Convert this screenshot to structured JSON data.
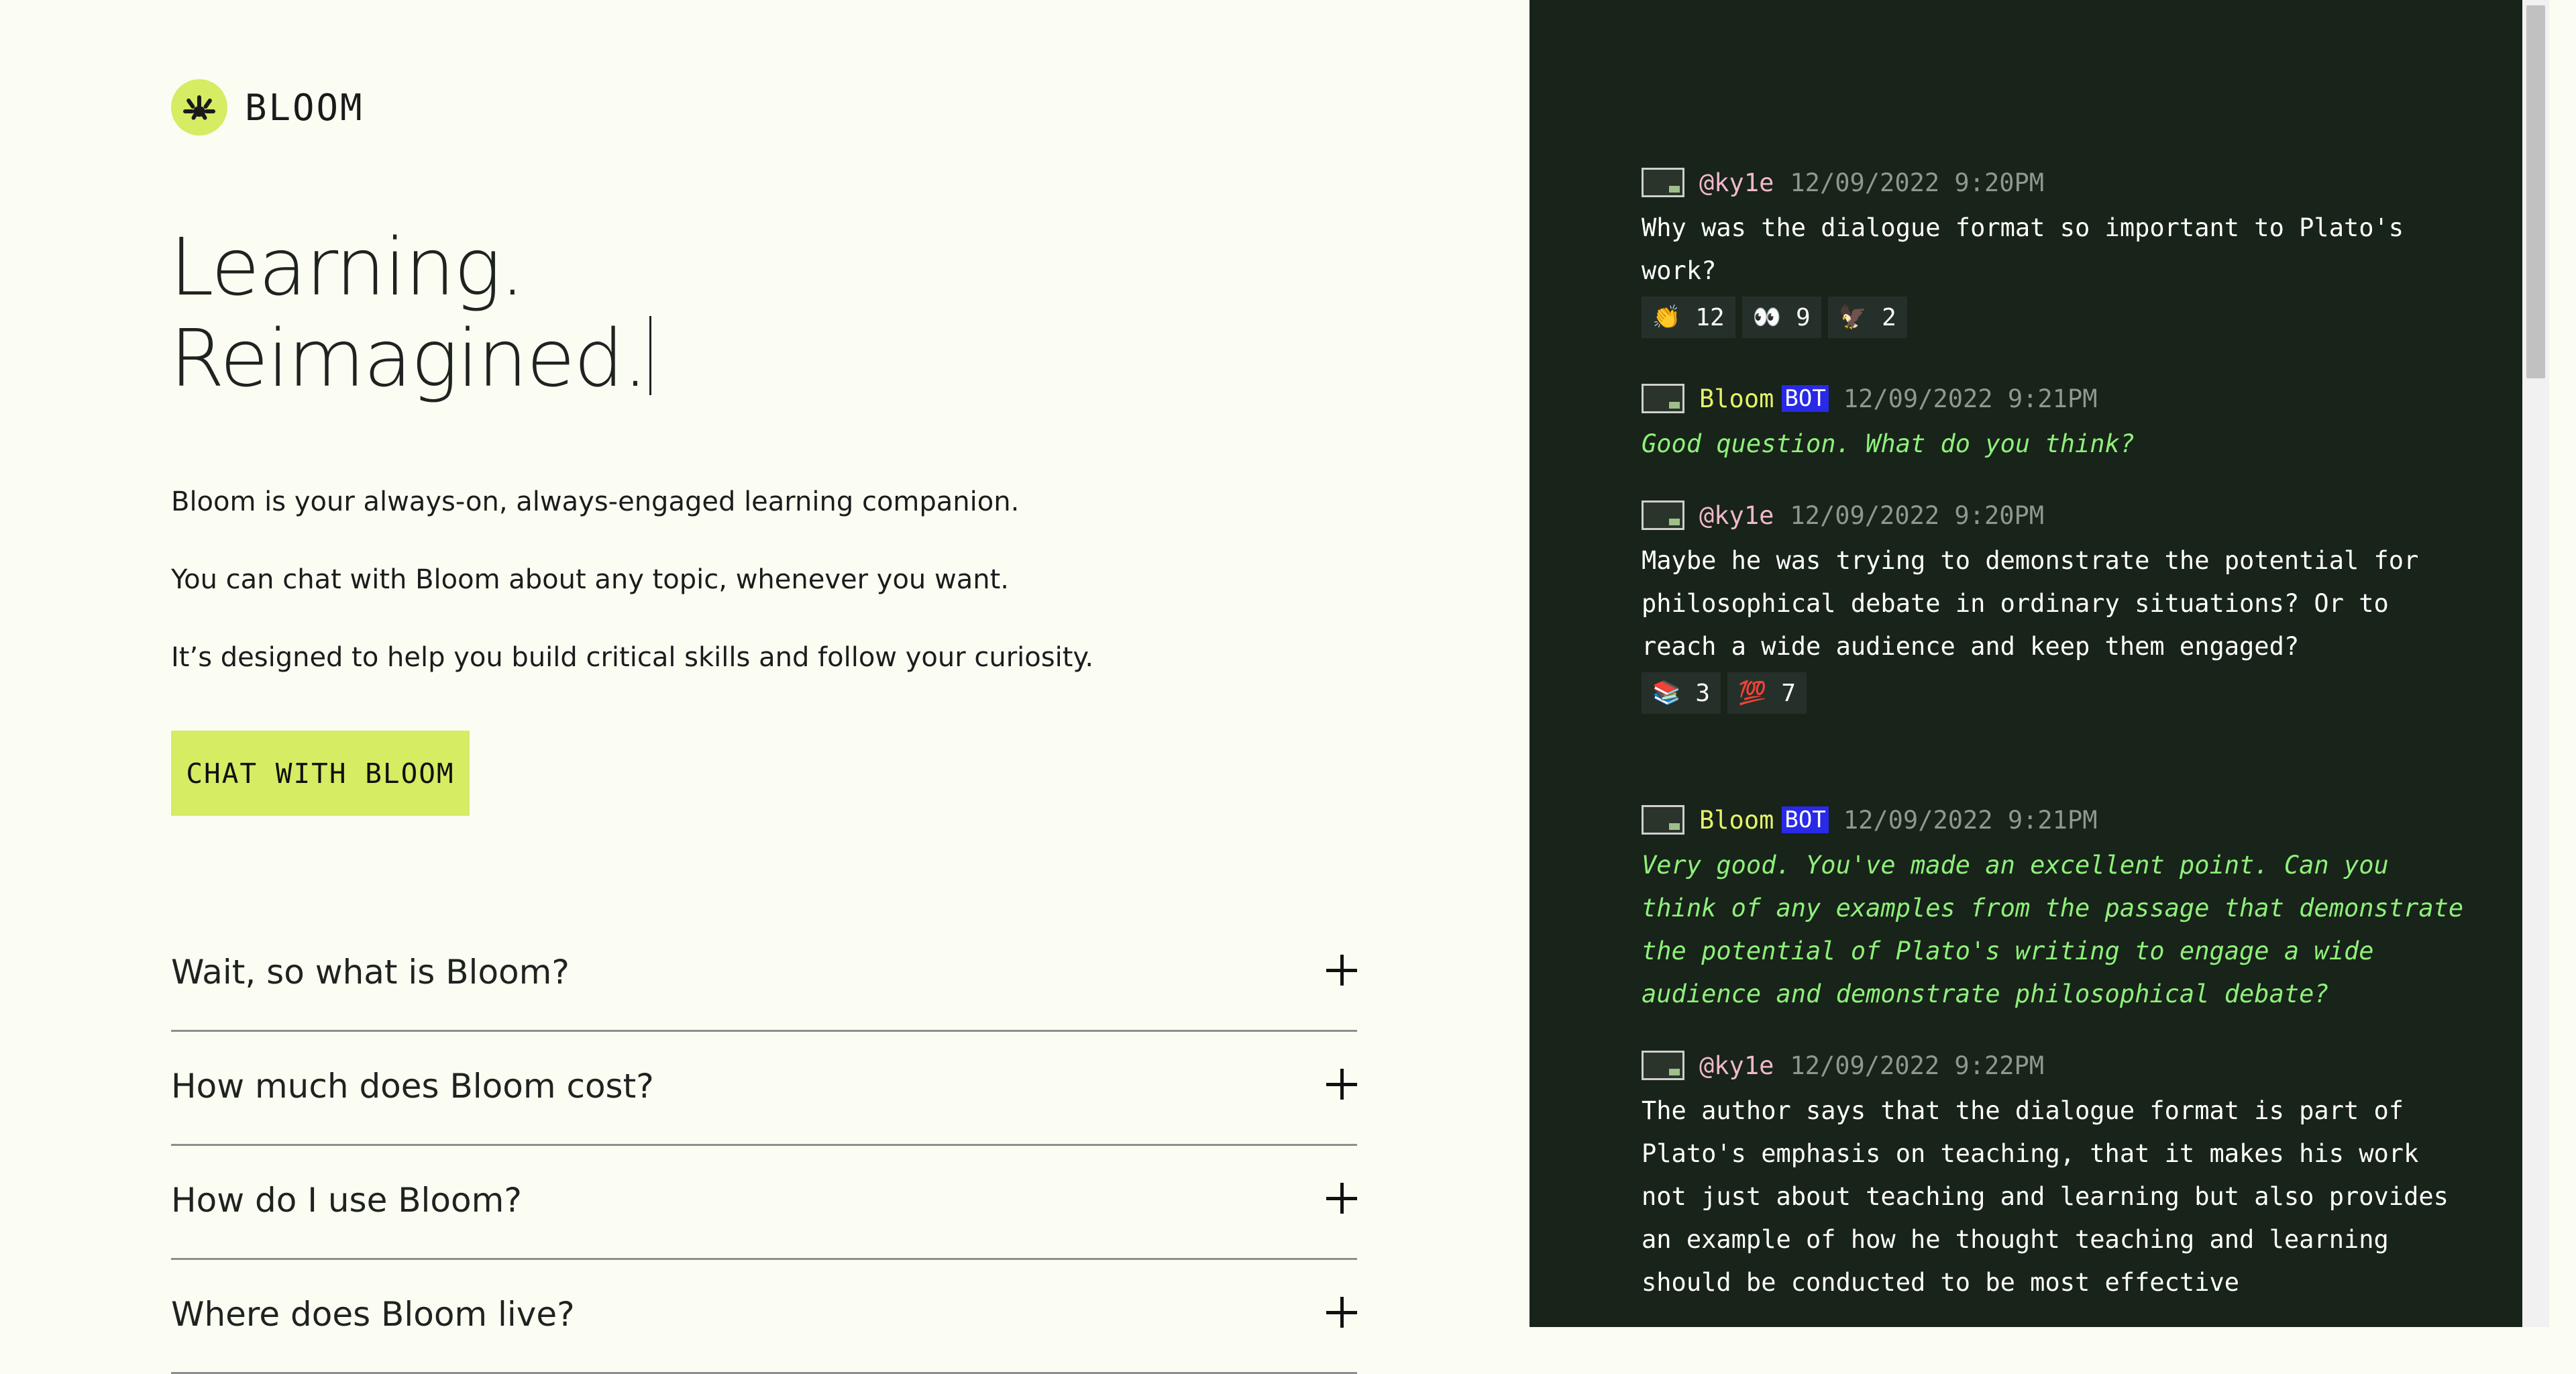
{
  "brand": {
    "name": "BLOOM"
  },
  "hero": {
    "line1": "Learning.",
    "line2": "Reimagined."
  },
  "intro": [
    "Bloom is your always-on, always-engaged learning companion.",
    "You can chat with Bloom about any topic, whenever you want.",
    "It’s designed to help you build critical skills and follow your curiosity."
  ],
  "cta": {
    "label": "CHAT WITH BLOOM"
  },
  "faq": [
    "Wait, so what is Bloom?",
    "How much does Bloom cost?",
    "How do I use Bloom?",
    "Where does Bloom live?"
  ],
  "chat": {
    "bot_tag": "BOT",
    "messages": [
      {
        "author": "@ky1e",
        "time": "12/09/2022 9:20PM",
        "text": "Why was the dialogue format so important to Plato's\nwork?",
        "reactions": [
          {
            "emoji": "👏",
            "count": "12"
          },
          {
            "emoji": "👀",
            "count": "9"
          },
          {
            "emoji": "🦅",
            "count": "2"
          }
        ]
      },
      {
        "author": "Bloom",
        "time": "12/09/2022 9:21PM",
        "text": "Good question. What do you think?"
      },
      {
        "author": "@ky1e",
        "time": "12/09/2022 9:20PM",
        "text": "Maybe he was trying to demonstrate the potential for\nphilosophical debate in ordinary situations? Or to\nreach a wide audience and keep them engaged?",
        "reactions": [
          {
            "emoji": "📚",
            "count": "3"
          },
          {
            "emoji": "💯",
            "count": "7"
          }
        ]
      },
      {
        "author": "Bloom",
        "time": "12/09/2022 9:21PM",
        "text": "Very good. You've made an excellent point. Can you\nthink of any examples from the passage that demonstrate\nthe potential of Plato's writing to engage a wide\naudience and demonstrate philosophical debate?"
      },
      {
        "author": "@ky1e",
        "time": "12/09/2022 9:22PM",
        "text": "The author says that the dialogue format is part of\nPlato's emphasis on teaching, that it makes his work\nnot just about teaching and learning but also provides\nan example of how he thought teaching and learning\nshould be conducted to be most effective"
      }
    ]
  },
  "colors": {
    "accent": "#d5ec63",
    "page_bg": "#fbfdf3",
    "chat_bg": "#182319",
    "bot_text": "#8ef07a",
    "bot_name": "#e5f26a",
    "user_name": "#f0b8cc",
    "bot_tag_bg": "#2929e8"
  }
}
